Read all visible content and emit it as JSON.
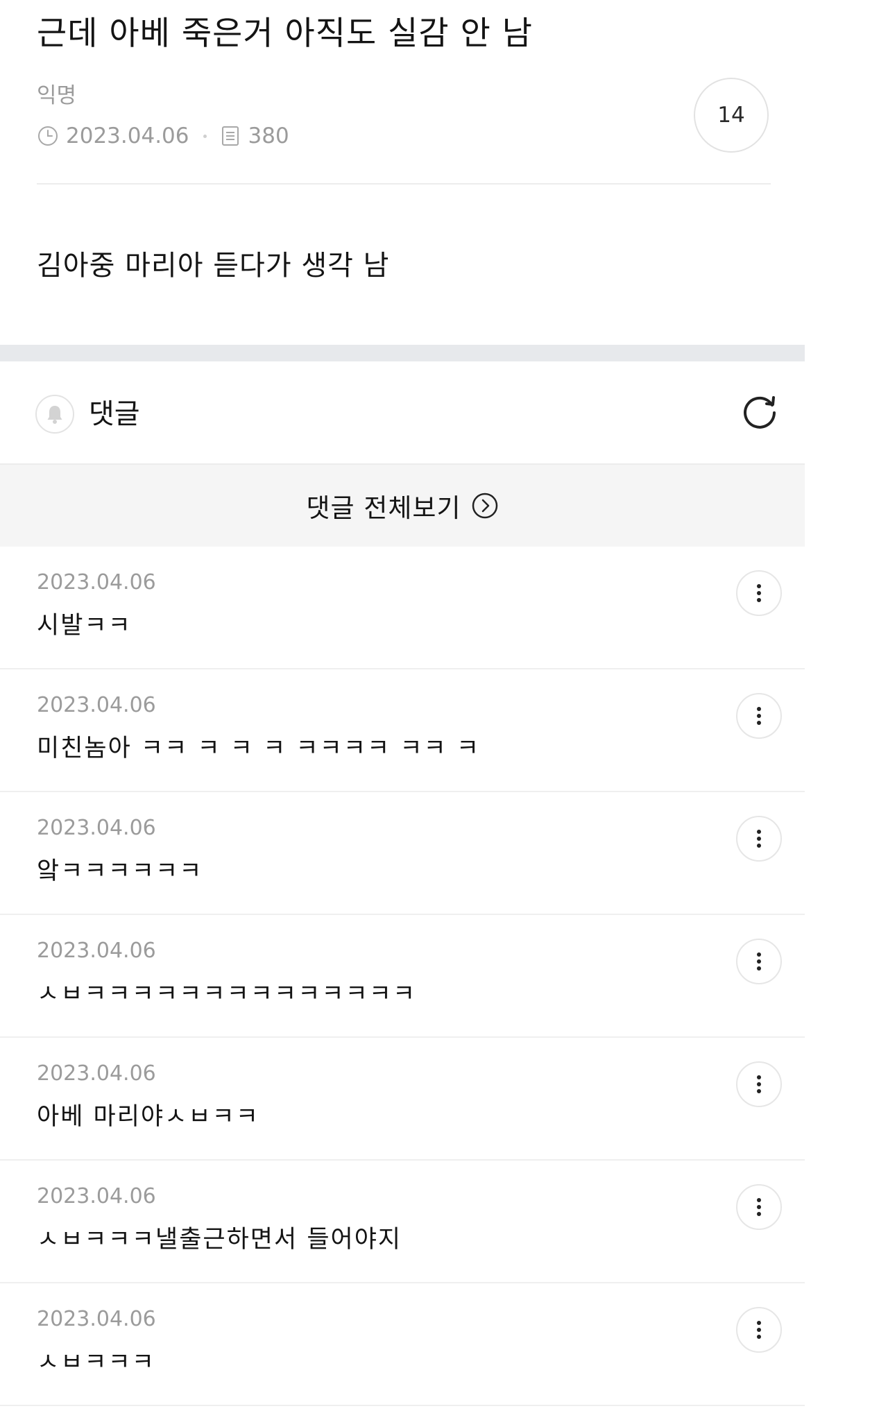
{
  "post": {
    "title": "근데 아베 죽은거 아직도 실감 안 남",
    "author": "익명",
    "date": "2023.04.06",
    "views": "380",
    "comment_count": "14",
    "body": "김아중 마리아 듣다가 생각 남"
  },
  "comments_section": {
    "label": "댓글",
    "view_all_label": "댓글 전체보기",
    "items": [
      {
        "date": "2023.04.06",
        "text": "시발ㅋㅋ"
      },
      {
        "date": "2023.04.06",
        "text": "미친놈아 ㅋㅋ ㅋ ㅋ ㅋ ㅋㅋㅋㅋ ㅋㅋ ㅋ"
      },
      {
        "date": "2023.04.06",
        "text": "앜ㅋㅋㅋㅋㅋㅋ"
      },
      {
        "date": "2023.04.06",
        "text": "ㅅㅂㅋㅋㅋㅋㅋㅋㅋㅋㅋㅋㅋㅋㅋㅋ"
      },
      {
        "date": "2023.04.06",
        "text": "아베 마리야ㅅㅂㅋㅋ"
      },
      {
        "date": "2023.04.06",
        "text": "ㅅㅂㅋㅋㅋ낼출근하면서 들어야지"
      },
      {
        "date": "2023.04.06",
        "text": "ㅅㅂㅋㅋㅋ"
      }
    ]
  },
  "icons": {
    "date": "clock-icon",
    "views": "document-icon",
    "notify": "bell-icon",
    "refresh": "refresh-icon",
    "view_all": "chevron-right-circle-icon",
    "more": "more-vertical-icon"
  },
  "colors": {
    "text": "#141414",
    "muted": "#9b9b9b",
    "divider": "#ececec",
    "band": "#e7e9ec",
    "view_all_bg": "#f5f5f5"
  }
}
